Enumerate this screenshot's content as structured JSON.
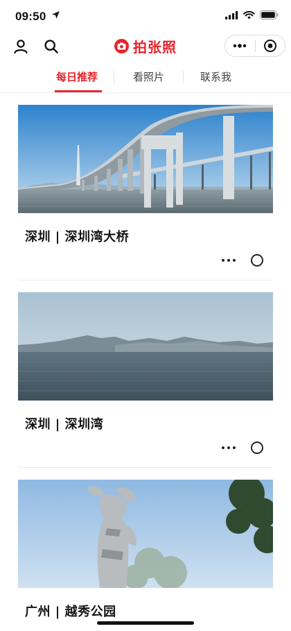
{
  "status_bar": {
    "time": "09:50"
  },
  "header": {
    "brand": "拍张照"
  },
  "tabs": [
    {
      "label": "每日推荐",
      "active": true
    },
    {
      "label": "看照片",
      "active": false
    },
    {
      "label": "联系我",
      "active": false
    }
  ],
  "cards": [
    {
      "title": "深圳 | 深圳湾大桥"
    },
    {
      "title": "深圳 | 深圳湾"
    },
    {
      "title": "广州 | 越秀公园"
    }
  ],
  "colors": {
    "accent": "#e8232b"
  },
  "icons": [
    "location-arrow-icon",
    "signal-icon",
    "wifi-icon",
    "battery-icon",
    "user-icon",
    "search-icon",
    "camera-icon",
    "more-icon",
    "record-icon"
  ]
}
